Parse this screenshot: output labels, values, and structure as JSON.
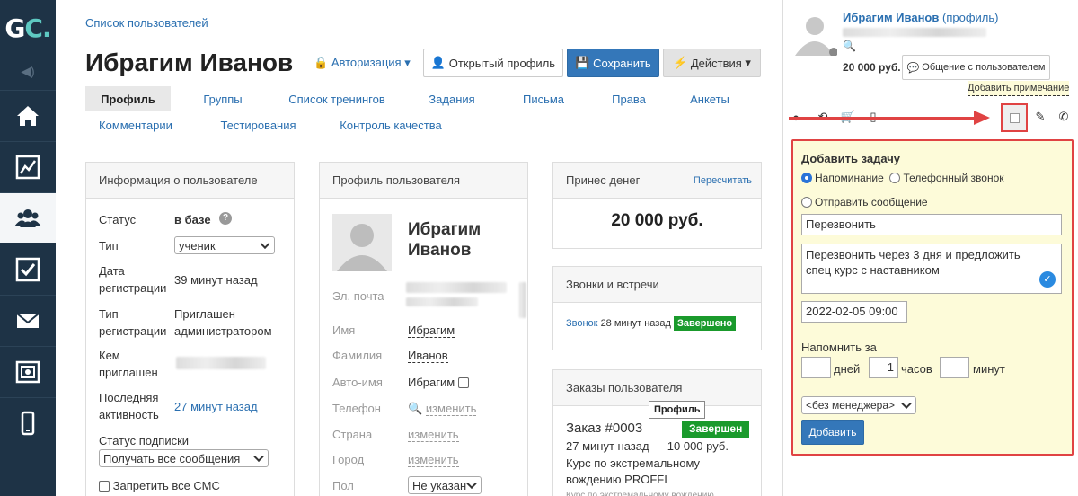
{
  "sidebar": {
    "logo_g": "G",
    "logo_c": "C.",
    "items": [
      "home-icon",
      "chart-icon",
      "users-icon",
      "checkbox-icon",
      "mail-icon",
      "safe-icon",
      "phone-icon"
    ]
  },
  "header": {
    "breadcrumb": "Список пользователей",
    "title": "Ибрагим Иванов",
    "auth_label": "Авторизация",
    "open_profile": "Открытый профиль",
    "save": "Сохранить",
    "actions": "Действия"
  },
  "tabs": [
    "Профиль",
    "Группы",
    "Список тренингов",
    "Задания",
    "Письма",
    "Права",
    "Анкеты",
    "Комментарии",
    "Тестирования",
    "Контроль качества"
  ],
  "info": {
    "header": "Информация о пользователе",
    "status_label": "Статус",
    "status_value": "в базе",
    "type_label": "Тип",
    "type_value": "ученик",
    "reg_date_label1": "Дата",
    "reg_date_label2": "регистрации",
    "reg_date_value": "39 минут назад",
    "reg_type_label1": "Тип",
    "reg_type_label2": "регистрации",
    "reg_type_value1": "Приглашен",
    "reg_type_value2": "администратором",
    "invited_label1": "Кем",
    "invited_label2": "приглашен",
    "last_label1": "Последняя",
    "last_label2": "активность",
    "last_value": "27 минут назад",
    "sub_label": "Статус подписки",
    "sub_value": "Получать все сообщения",
    "sms_label": "Запретить все СМС"
  },
  "profile": {
    "header": "Профиль пользователя",
    "name1": "Ибрагим",
    "name2": "Иванов",
    "email_label": "Эл. почта",
    "first_label": "Имя",
    "first_value": "Ибрагим",
    "last_label": "Фамилия",
    "last_value": "Иванов",
    "auto_label": "Авто-имя",
    "auto_value": "Ибрагим",
    "phone_label": "Телефон",
    "change": "изменить",
    "country_label": "Страна",
    "city_label": "Город",
    "gender_label": "Пол",
    "gender_value": "Не указан"
  },
  "money": {
    "header": "Принес денег",
    "recalc": "Пересчитать",
    "amount": "20 000 руб."
  },
  "calls": {
    "header": "Звонки и встречи",
    "call": "Звонок",
    "time": "28 минут назад",
    "status": "Завершено"
  },
  "orders": {
    "header": "Заказы пользователя",
    "order": "Заказ #0003",
    "status": "Завершен",
    "meta": "27 минут назад — 10 000 руб.",
    "desc1": "Курс по экстремальному",
    "desc2": "вождению PROFFI",
    "desc3": "Курс по экстремальному вождению",
    "tooltip": "Профиль"
  },
  "side": {
    "name": "Ибрагим Иванов",
    "profile_link": "(профиль)",
    "amount": "20 000 руб.",
    "chat": "Общение с пользователем",
    "add_note": "Добавить примечание"
  },
  "task": {
    "title": "Добавить задачу",
    "opt_reminder": "Напоминание",
    "opt_call": "Телефонный звонок",
    "opt_message": "Отправить сообщение",
    "subject": "Перезвонить",
    "text": "Перезвонить через 3 дня и предложить спец курс с наставником",
    "date": "2022-02-05 09:00",
    "remind_label": "Напомнить за",
    "days_value": "",
    "days": "дней",
    "hours_value": "1",
    "hours": "часов",
    "minutes_value": "",
    "minutes": "минут",
    "manager": "<без менеджера>",
    "add": "Добавить"
  },
  "colors": {
    "accent": "#3477b9",
    "nav": "#1e3346",
    "success": "#1a9a2c",
    "highlight": "#e04343"
  }
}
